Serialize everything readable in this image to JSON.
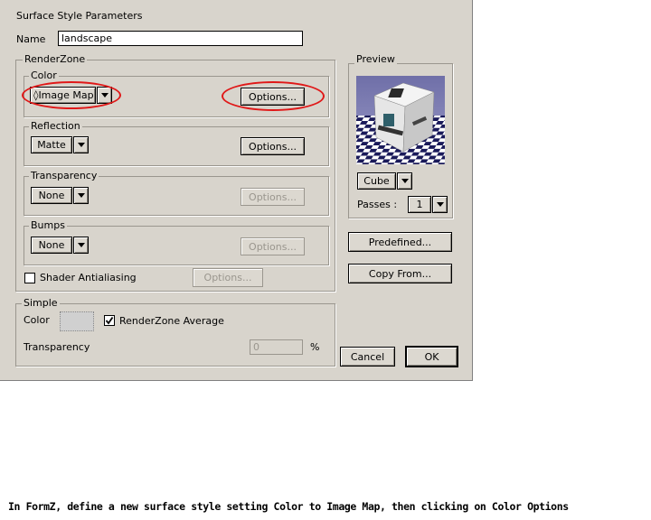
{
  "dialog": {
    "title": "Surface Style Parameters",
    "name_label": "Name",
    "name_value": "landscape"
  },
  "renderzone": {
    "legend": "RenderZone",
    "color": {
      "legend": "Color",
      "popup_value": "Image Map",
      "options": "Options..."
    },
    "reflection": {
      "legend": "Reflection",
      "popup_value": "Matte",
      "options": "Options..."
    },
    "transparency": {
      "legend": "Transparency",
      "popup_value": "None",
      "options": "Options..."
    },
    "bumps": {
      "legend": "Bumps",
      "popup_value": "None",
      "options": "Options..."
    },
    "shader_antialiasing": {
      "label": "Shader Antialiasing",
      "checked": false,
      "options": "Options..."
    }
  },
  "preview": {
    "legend": "Preview",
    "image_alt": "autodessys cube preview",
    "shape_value": "Cube",
    "passes_label": "Passes :",
    "passes_value": "1"
  },
  "side_buttons": {
    "predefined": "Predefined...",
    "copy_from": "Copy From..."
  },
  "simple": {
    "legend": "Simple",
    "color_label": "Color",
    "renderzone_average_label": "RenderZone Average",
    "renderzone_average_checked": true,
    "transparency_label": "Transparency",
    "transparency_value": "0",
    "percent": "%"
  },
  "footer": {
    "cancel": "Cancel",
    "ok": "OK"
  },
  "annotation_color": "#e01818",
  "caption": "In FormZ, define a new surface style setting Color to Image Map, then clicking on Color Options"
}
